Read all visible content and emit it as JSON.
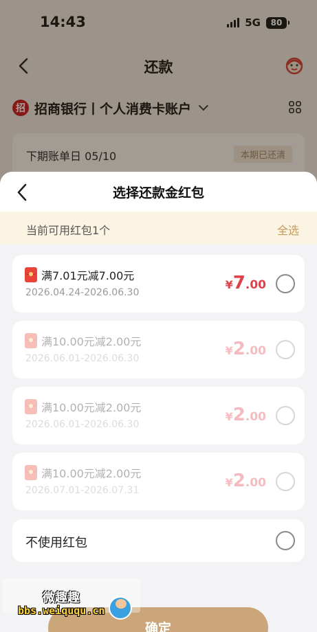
{
  "status_bar": {
    "time": "14:43",
    "network": "5G",
    "battery": "80"
  },
  "nav": {
    "title": "还款"
  },
  "account": {
    "bank_logo_glyph": "招",
    "name": "招商银行丨个人消费卡账户"
  },
  "bill": {
    "next_bill_date": "下期账单日 05/10",
    "status_badge": "本期已还清"
  },
  "sheet": {
    "title": "选择还款金红包",
    "available_text": "当前可用红包1个",
    "select_all": "全选",
    "coupons": [
      {
        "name": "满7.01元减7.00元",
        "validity": "2026.04.24-2026.06.30",
        "currency": "¥",
        "amount_int": "7",
        "amount_dec": ".00",
        "enabled": true
      },
      {
        "name": "满10.00元减2.00元",
        "validity": "2026.06.01-2026.06.30",
        "currency": "¥",
        "amount_int": "2",
        "amount_dec": ".00",
        "enabled": false
      },
      {
        "name": "满10.00元减2.00元",
        "validity": "2026.06.01-2026.06.30",
        "currency": "¥",
        "amount_int": "2",
        "amount_dec": ".00",
        "enabled": false
      },
      {
        "name": "满10.00元减2.00元",
        "validity": "2026.07.01-2026.07.31",
        "currency": "¥",
        "amount_int": "2",
        "amount_dec": ".00",
        "enabled": false
      }
    ],
    "no_coupon_label": "不使用红包",
    "confirm_label": "确定"
  },
  "watermark": {
    "title": "微趣趣",
    "url": "bbs.weiququ.cn"
  },
  "colors": {
    "accent_gold": "#c49a5c",
    "amount_red": "#e0424a",
    "bank_red": "#c8161d",
    "confirm_bg": "#cba67a"
  },
  "icons": [
    "back-chevron-icon",
    "customer-service-icon",
    "bank-logo-icon",
    "grid-icon",
    "chevron-down-icon",
    "red-envelope-icon",
    "radio-icon"
  ]
}
